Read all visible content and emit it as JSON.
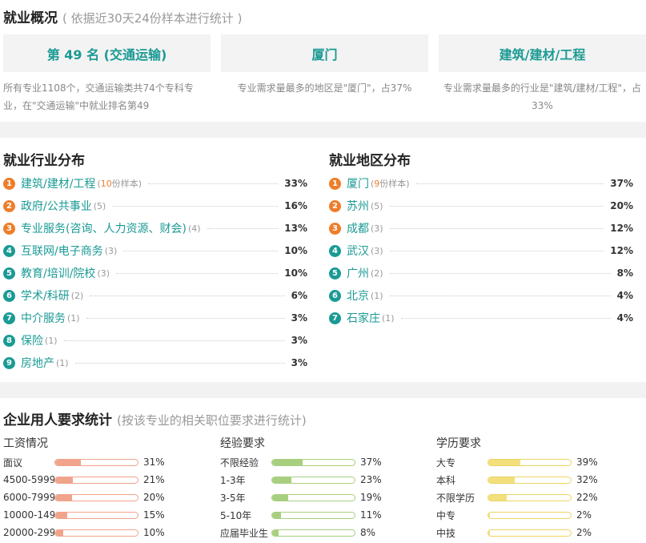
{
  "overview": {
    "title": "就业概况",
    "subtitle": "( 依据近30天24份样本进行统计 )",
    "cards": [
      {
        "value": "第 49 名 (交通运输)",
        "desc": "所有专业1108个，交通运输类共74个专科专业，在\"交通运输\"中就业排名第49"
      },
      {
        "value": "厦门",
        "desc": "专业需求量最多的地区是\"厦门\"，占37%"
      },
      {
        "value": "建筑/建材/工程",
        "desc": "专业需求量最多的行业是\"建筑/建材/工程\"，占33%"
      }
    ]
  },
  "industry": {
    "title": "就业行业分布",
    "items": [
      {
        "rank": "1",
        "name": "建筑/建材/工程",
        "count_num": "10",
        "count_suffix": "份样本)",
        "pct": "33%"
      },
      {
        "rank": "2",
        "name": "政府/公共事业",
        "count": "(5)",
        "pct": "16%"
      },
      {
        "rank": "3",
        "name": "专业服务(咨询、人力资源、财会)",
        "count": "(4)",
        "pct": "13%"
      },
      {
        "rank": "4",
        "name": "互联网/电子商务",
        "count": "(3)",
        "pct": "10%"
      },
      {
        "rank": "5",
        "name": "教育/培训/院校",
        "count": "(3)",
        "pct": "10%"
      },
      {
        "rank": "6",
        "name": "学术/科研",
        "count": "(2)",
        "pct": "6%"
      },
      {
        "rank": "7",
        "name": "中介服务",
        "count": "(1)",
        "pct": "3%"
      },
      {
        "rank": "8",
        "name": "保险",
        "count": "(1)",
        "pct": "3%"
      },
      {
        "rank": "9",
        "name": "房地产",
        "count": "(1)",
        "pct": "3%"
      }
    ]
  },
  "region": {
    "title": "就业地区分布",
    "items": [
      {
        "rank": "1",
        "name": "厦门",
        "count_num": "9",
        "count_suffix": "份样本)",
        "pct": "37%"
      },
      {
        "rank": "2",
        "name": "苏州",
        "count": "(5)",
        "pct": "20%"
      },
      {
        "rank": "3",
        "name": "成都",
        "count": "(3)",
        "pct": "12%"
      },
      {
        "rank": "4",
        "name": "武汉",
        "count": "(3)",
        "pct": "12%"
      },
      {
        "rank": "5",
        "name": "广州",
        "count": "(2)",
        "pct": "8%"
      },
      {
        "rank": "6",
        "name": "北京",
        "count": "(1)",
        "pct": "4%"
      },
      {
        "rank": "7",
        "name": "石家庄",
        "count": "(1)",
        "pct": "4%"
      }
    ]
  },
  "requirements": {
    "title": "企业用人要求统计",
    "subtitle": "(按该专业的相关职位要求进行统计)",
    "salary": {
      "title": "工资情况",
      "items": [
        {
          "label": "面议",
          "pct": "31%",
          "value": 31
        },
        {
          "label": "4500-5999",
          "pct": "21%",
          "value": 21
        },
        {
          "label": "6000-7999",
          "pct": "20%",
          "value": 20
        },
        {
          "label": "10000-14999",
          "pct": "15%",
          "value": 15
        },
        {
          "label": "20000-29999",
          "pct": "10%",
          "value": 10
        }
      ]
    },
    "experience": {
      "title": "经验要求",
      "items": [
        {
          "label": "不限经验",
          "pct": "37%",
          "value": 37
        },
        {
          "label": "1-3年",
          "pct": "23%",
          "value": 23
        },
        {
          "label": "3-5年",
          "pct": "19%",
          "value": 19
        },
        {
          "label": "5-10年",
          "pct": "11%",
          "value": 11
        },
        {
          "label": "应届毕业生",
          "pct": "8%",
          "value": 8
        }
      ]
    },
    "education": {
      "title": "学历要求",
      "items": [
        {
          "label": "大专",
          "pct": "39%",
          "value": 39
        },
        {
          "label": "本科",
          "pct": "32%",
          "value": 32
        },
        {
          "label": "不限学历",
          "pct": "22%",
          "value": 22
        },
        {
          "label": "中专",
          "pct": "2%",
          "value": 2
        },
        {
          "label": "中技",
          "pct": "2%",
          "value": 2
        }
      ]
    }
  },
  "colors": {
    "teal": "#1a9a94",
    "orange": "#ee7d2a",
    "salary": "#f0a48c",
    "experience": "#a8cf7f",
    "education": "#ecd462"
  }
}
